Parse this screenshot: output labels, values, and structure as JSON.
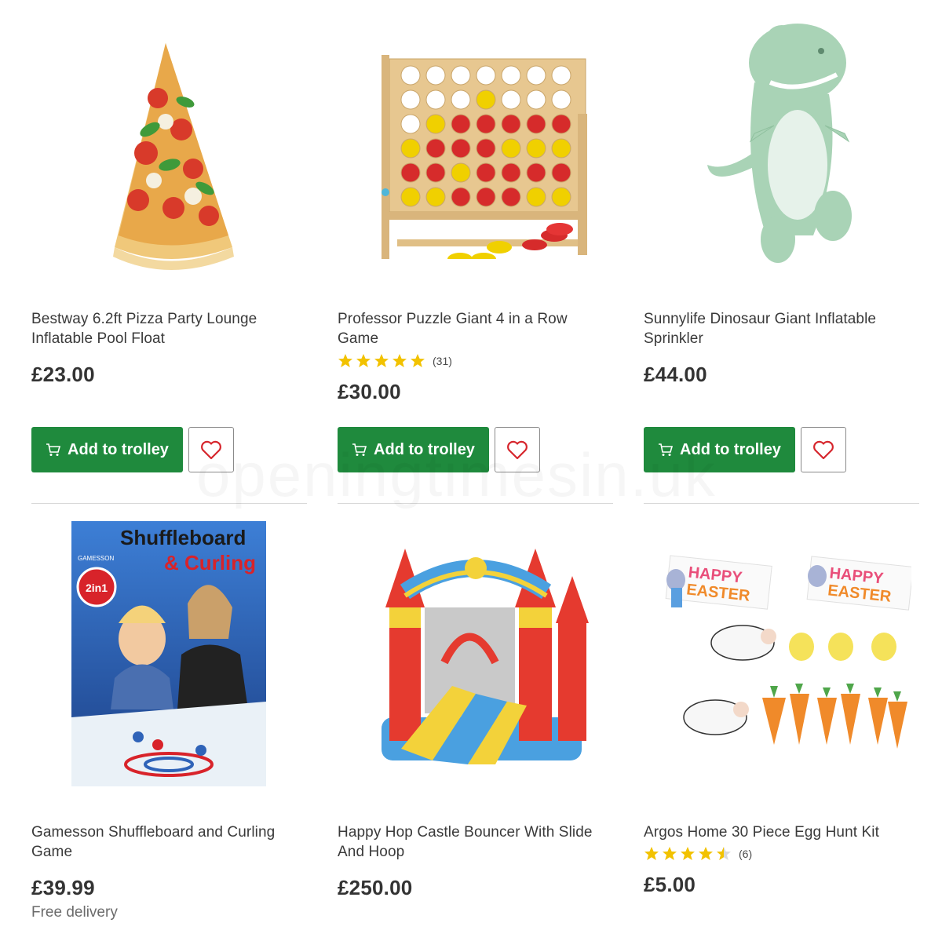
{
  "watermark": "openingtimesin.uk",
  "products": [
    {
      "title": "Bestway 6.2ft Pizza Party Lounge Inflatable Pool Float",
      "price": "£23.00",
      "button": "Add to trolley",
      "image_icon": "pizza-float-image"
    },
    {
      "title": "Professor Puzzle Giant 4 in a Row Game",
      "rating_value": 5,
      "rating_count": "(31)",
      "price": "£30.00",
      "button": "Add to trolley",
      "image_icon": "connect-four-image"
    },
    {
      "title": "Sunnylife Dinosaur Giant Inflatable Sprinkler",
      "price": "£44.00",
      "button": "Add to trolley",
      "image_icon": "dinosaur-sprinkler-image"
    },
    {
      "title": "Gamesson Shuffleboard and Curling Game",
      "price": "£39.99",
      "delivery": "Free delivery",
      "image_icon": "shuffleboard-box-image",
      "box_title_1": "Shuffleboard",
      "box_title_2": "& Curling",
      "box_brand": "GAMESSON",
      "box_badge": "2in1"
    },
    {
      "title": "Happy Hop Castle Bouncer With Slide And Hoop",
      "price": "£250.00",
      "image_icon": "bouncy-castle-image"
    },
    {
      "title": "Argos Home 30 Piece Egg Hunt Kit",
      "rating_value": 4.5,
      "rating_count": "(6)",
      "price": "£5.00",
      "image_icon": "easter-egg-hunt-image",
      "sign_text_1": "HAPPY",
      "sign_text_2": "EASTER"
    }
  ],
  "colors": {
    "button_green": "#1f8a3d",
    "star_yellow": "#f2c200",
    "heart_red": "#d6252c"
  }
}
